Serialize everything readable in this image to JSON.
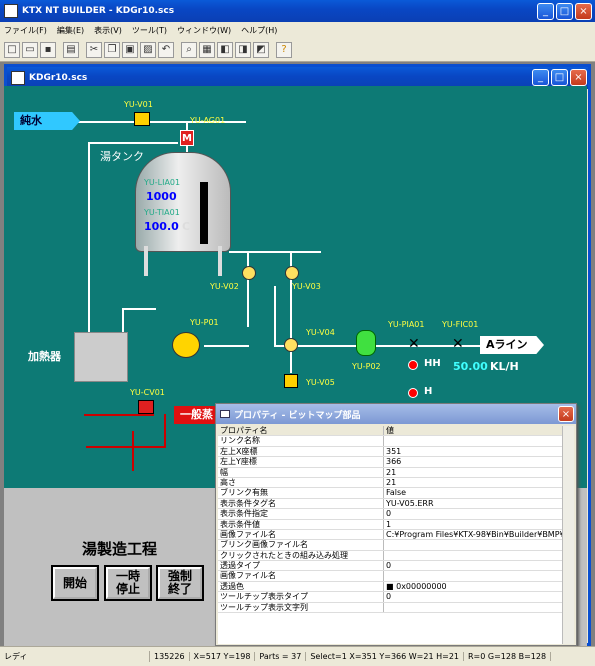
{
  "app": {
    "title": "KTX NT BUILDER - KDGr10.scs"
  },
  "menu": [
    "ファイル(F)",
    "編集(E)",
    "表示(V)",
    "ツール(T)",
    "ウィンドウ(W)",
    "ヘルプ(H)"
  ],
  "child": {
    "title": "KDGr10.scs"
  },
  "diagram": {
    "pure_water": "純水",
    "tank": "湯タンク",
    "heater": "加熱器",
    "line_a": "Aライン",
    "steam": "一般蒸",
    "v01": "YU-V01",
    "ag01": "YU-AG01",
    "lia01": "YU-LIA01",
    "tia01": "YU-TIA01",
    "v02": "YU-V02",
    "v03": "YU-V03",
    "p01": "YU-P01",
    "v04": "YU-V04",
    "v05": "YU-V05",
    "p02": "YU-P02",
    "pia01": "YU-PIA01",
    "fic01": "YU-FIC01",
    "cv01": "YU-CV01",
    "level": "1000",
    "temp": "100.0",
    "temp_unit": "C",
    "flow": "50.00",
    "flow_unit": "KL/H",
    "hh": "HH",
    "h": "H",
    "m": "M"
  },
  "process": {
    "title": "湯製造工程",
    "start": "開始",
    "pause": "一時\n停止",
    "force_end": "強制\n終了"
  },
  "props": {
    "title": "プロパティ - ビットマップ部品",
    "header": {
      "k": "プロパティ名",
      "v": "値"
    },
    "rows": [
      {
        "k": "リンク名称",
        "v": ""
      },
      {
        "k": "左上X座標",
        "v": "351"
      },
      {
        "k": "左上Y座標",
        "v": "366"
      },
      {
        "k": "幅",
        "v": "21"
      },
      {
        "k": "高さ",
        "v": "21"
      },
      {
        "k": "ブリンク有無",
        "v": "False"
      },
      {
        "k": "表示条件タグ名",
        "v": "YU-V05.ERR"
      },
      {
        "k": "表示条件指定",
        "v": "0"
      },
      {
        "k": "表示条件値",
        "v": "1"
      },
      {
        "k": "画像ファイル名",
        "v": "C:¥Program Files¥KTX-98¥Bin¥Builder¥BMP¥"
      },
      {
        "k": "ブリンク画像ファイル名",
        "v": ""
      },
      {
        "k": "クリックされたときの組み込み処理",
        "v": ""
      },
      {
        "k": "透過タイプ",
        "v": "0"
      },
      {
        "k": "画像ファイル名",
        "v": ""
      },
      {
        "k": "透過色",
        "v": "■ 0x00000000"
      },
      {
        "k": "ツールチップ表示タイプ",
        "v": "0"
      },
      {
        "k": "ツールチップ表示文字列",
        "v": ""
      }
    ]
  },
  "status": {
    "ready": "レディ",
    "code": "135226",
    "xy": "X=517 Y=198",
    "parts": "Parts = 37",
    "sel": "Select=1 X=351 Y=366 W=21 H=21",
    "rgb": "R=0 G=128 B=128"
  }
}
